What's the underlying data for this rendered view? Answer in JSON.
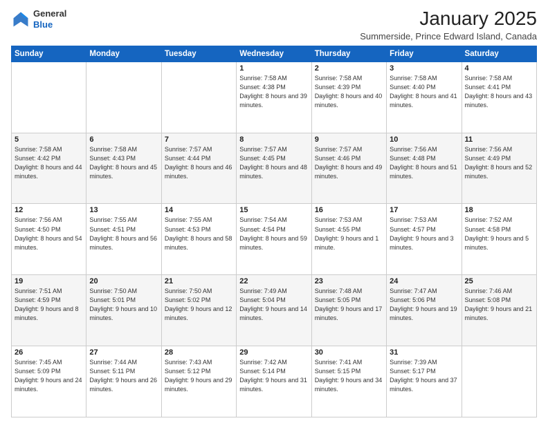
{
  "brand": {
    "general": "General",
    "blue": "Blue"
  },
  "header": {
    "month": "January 2025",
    "location": "Summerside, Prince Edward Island, Canada"
  },
  "weekdays": [
    "Sunday",
    "Monday",
    "Tuesday",
    "Wednesday",
    "Thursday",
    "Friday",
    "Saturday"
  ],
  "weeks": [
    [
      {
        "day": "",
        "sunrise": "",
        "sunset": "",
        "daylight": ""
      },
      {
        "day": "",
        "sunrise": "",
        "sunset": "",
        "daylight": ""
      },
      {
        "day": "",
        "sunrise": "",
        "sunset": "",
        "daylight": ""
      },
      {
        "day": "1",
        "sunrise": "Sunrise: 7:58 AM",
        "sunset": "Sunset: 4:38 PM",
        "daylight": "Daylight: 8 hours and 39 minutes."
      },
      {
        "day": "2",
        "sunrise": "Sunrise: 7:58 AM",
        "sunset": "Sunset: 4:39 PM",
        "daylight": "Daylight: 8 hours and 40 minutes."
      },
      {
        "day": "3",
        "sunrise": "Sunrise: 7:58 AM",
        "sunset": "Sunset: 4:40 PM",
        "daylight": "Daylight: 8 hours and 41 minutes."
      },
      {
        "day": "4",
        "sunrise": "Sunrise: 7:58 AM",
        "sunset": "Sunset: 4:41 PM",
        "daylight": "Daylight: 8 hours and 43 minutes."
      }
    ],
    [
      {
        "day": "5",
        "sunrise": "Sunrise: 7:58 AM",
        "sunset": "Sunset: 4:42 PM",
        "daylight": "Daylight: 8 hours and 44 minutes."
      },
      {
        "day": "6",
        "sunrise": "Sunrise: 7:58 AM",
        "sunset": "Sunset: 4:43 PM",
        "daylight": "Daylight: 8 hours and 45 minutes."
      },
      {
        "day": "7",
        "sunrise": "Sunrise: 7:57 AM",
        "sunset": "Sunset: 4:44 PM",
        "daylight": "Daylight: 8 hours and 46 minutes."
      },
      {
        "day": "8",
        "sunrise": "Sunrise: 7:57 AM",
        "sunset": "Sunset: 4:45 PM",
        "daylight": "Daylight: 8 hours and 48 minutes."
      },
      {
        "day": "9",
        "sunrise": "Sunrise: 7:57 AM",
        "sunset": "Sunset: 4:46 PM",
        "daylight": "Daylight: 8 hours and 49 minutes."
      },
      {
        "day": "10",
        "sunrise": "Sunrise: 7:56 AM",
        "sunset": "Sunset: 4:48 PM",
        "daylight": "Daylight: 8 hours and 51 minutes."
      },
      {
        "day": "11",
        "sunrise": "Sunrise: 7:56 AM",
        "sunset": "Sunset: 4:49 PM",
        "daylight": "Daylight: 8 hours and 52 minutes."
      }
    ],
    [
      {
        "day": "12",
        "sunrise": "Sunrise: 7:56 AM",
        "sunset": "Sunset: 4:50 PM",
        "daylight": "Daylight: 8 hours and 54 minutes."
      },
      {
        "day": "13",
        "sunrise": "Sunrise: 7:55 AM",
        "sunset": "Sunset: 4:51 PM",
        "daylight": "Daylight: 8 hours and 56 minutes."
      },
      {
        "day": "14",
        "sunrise": "Sunrise: 7:55 AM",
        "sunset": "Sunset: 4:53 PM",
        "daylight": "Daylight: 8 hours and 58 minutes."
      },
      {
        "day": "15",
        "sunrise": "Sunrise: 7:54 AM",
        "sunset": "Sunset: 4:54 PM",
        "daylight": "Daylight: 8 hours and 59 minutes."
      },
      {
        "day": "16",
        "sunrise": "Sunrise: 7:53 AM",
        "sunset": "Sunset: 4:55 PM",
        "daylight": "Daylight: 9 hours and 1 minute."
      },
      {
        "day": "17",
        "sunrise": "Sunrise: 7:53 AM",
        "sunset": "Sunset: 4:57 PM",
        "daylight": "Daylight: 9 hours and 3 minutes."
      },
      {
        "day": "18",
        "sunrise": "Sunrise: 7:52 AM",
        "sunset": "Sunset: 4:58 PM",
        "daylight": "Daylight: 9 hours and 5 minutes."
      }
    ],
    [
      {
        "day": "19",
        "sunrise": "Sunrise: 7:51 AM",
        "sunset": "Sunset: 4:59 PM",
        "daylight": "Daylight: 9 hours and 8 minutes."
      },
      {
        "day": "20",
        "sunrise": "Sunrise: 7:50 AM",
        "sunset": "Sunset: 5:01 PM",
        "daylight": "Daylight: 9 hours and 10 minutes."
      },
      {
        "day": "21",
        "sunrise": "Sunrise: 7:50 AM",
        "sunset": "Sunset: 5:02 PM",
        "daylight": "Daylight: 9 hours and 12 minutes."
      },
      {
        "day": "22",
        "sunrise": "Sunrise: 7:49 AM",
        "sunset": "Sunset: 5:04 PM",
        "daylight": "Daylight: 9 hours and 14 minutes."
      },
      {
        "day": "23",
        "sunrise": "Sunrise: 7:48 AM",
        "sunset": "Sunset: 5:05 PM",
        "daylight": "Daylight: 9 hours and 17 minutes."
      },
      {
        "day": "24",
        "sunrise": "Sunrise: 7:47 AM",
        "sunset": "Sunset: 5:06 PM",
        "daylight": "Daylight: 9 hours and 19 minutes."
      },
      {
        "day": "25",
        "sunrise": "Sunrise: 7:46 AM",
        "sunset": "Sunset: 5:08 PM",
        "daylight": "Daylight: 9 hours and 21 minutes."
      }
    ],
    [
      {
        "day": "26",
        "sunrise": "Sunrise: 7:45 AM",
        "sunset": "Sunset: 5:09 PM",
        "daylight": "Daylight: 9 hours and 24 minutes."
      },
      {
        "day": "27",
        "sunrise": "Sunrise: 7:44 AM",
        "sunset": "Sunset: 5:11 PM",
        "daylight": "Daylight: 9 hours and 26 minutes."
      },
      {
        "day": "28",
        "sunrise": "Sunrise: 7:43 AM",
        "sunset": "Sunset: 5:12 PM",
        "daylight": "Daylight: 9 hours and 29 minutes."
      },
      {
        "day": "29",
        "sunrise": "Sunrise: 7:42 AM",
        "sunset": "Sunset: 5:14 PM",
        "daylight": "Daylight: 9 hours and 31 minutes."
      },
      {
        "day": "30",
        "sunrise": "Sunrise: 7:41 AM",
        "sunset": "Sunset: 5:15 PM",
        "daylight": "Daylight: 9 hours and 34 minutes."
      },
      {
        "day": "31",
        "sunrise": "Sunrise: 7:39 AM",
        "sunset": "Sunset: 5:17 PM",
        "daylight": "Daylight: 9 hours and 37 minutes."
      },
      {
        "day": "",
        "sunrise": "",
        "sunset": "",
        "daylight": ""
      }
    ]
  ]
}
